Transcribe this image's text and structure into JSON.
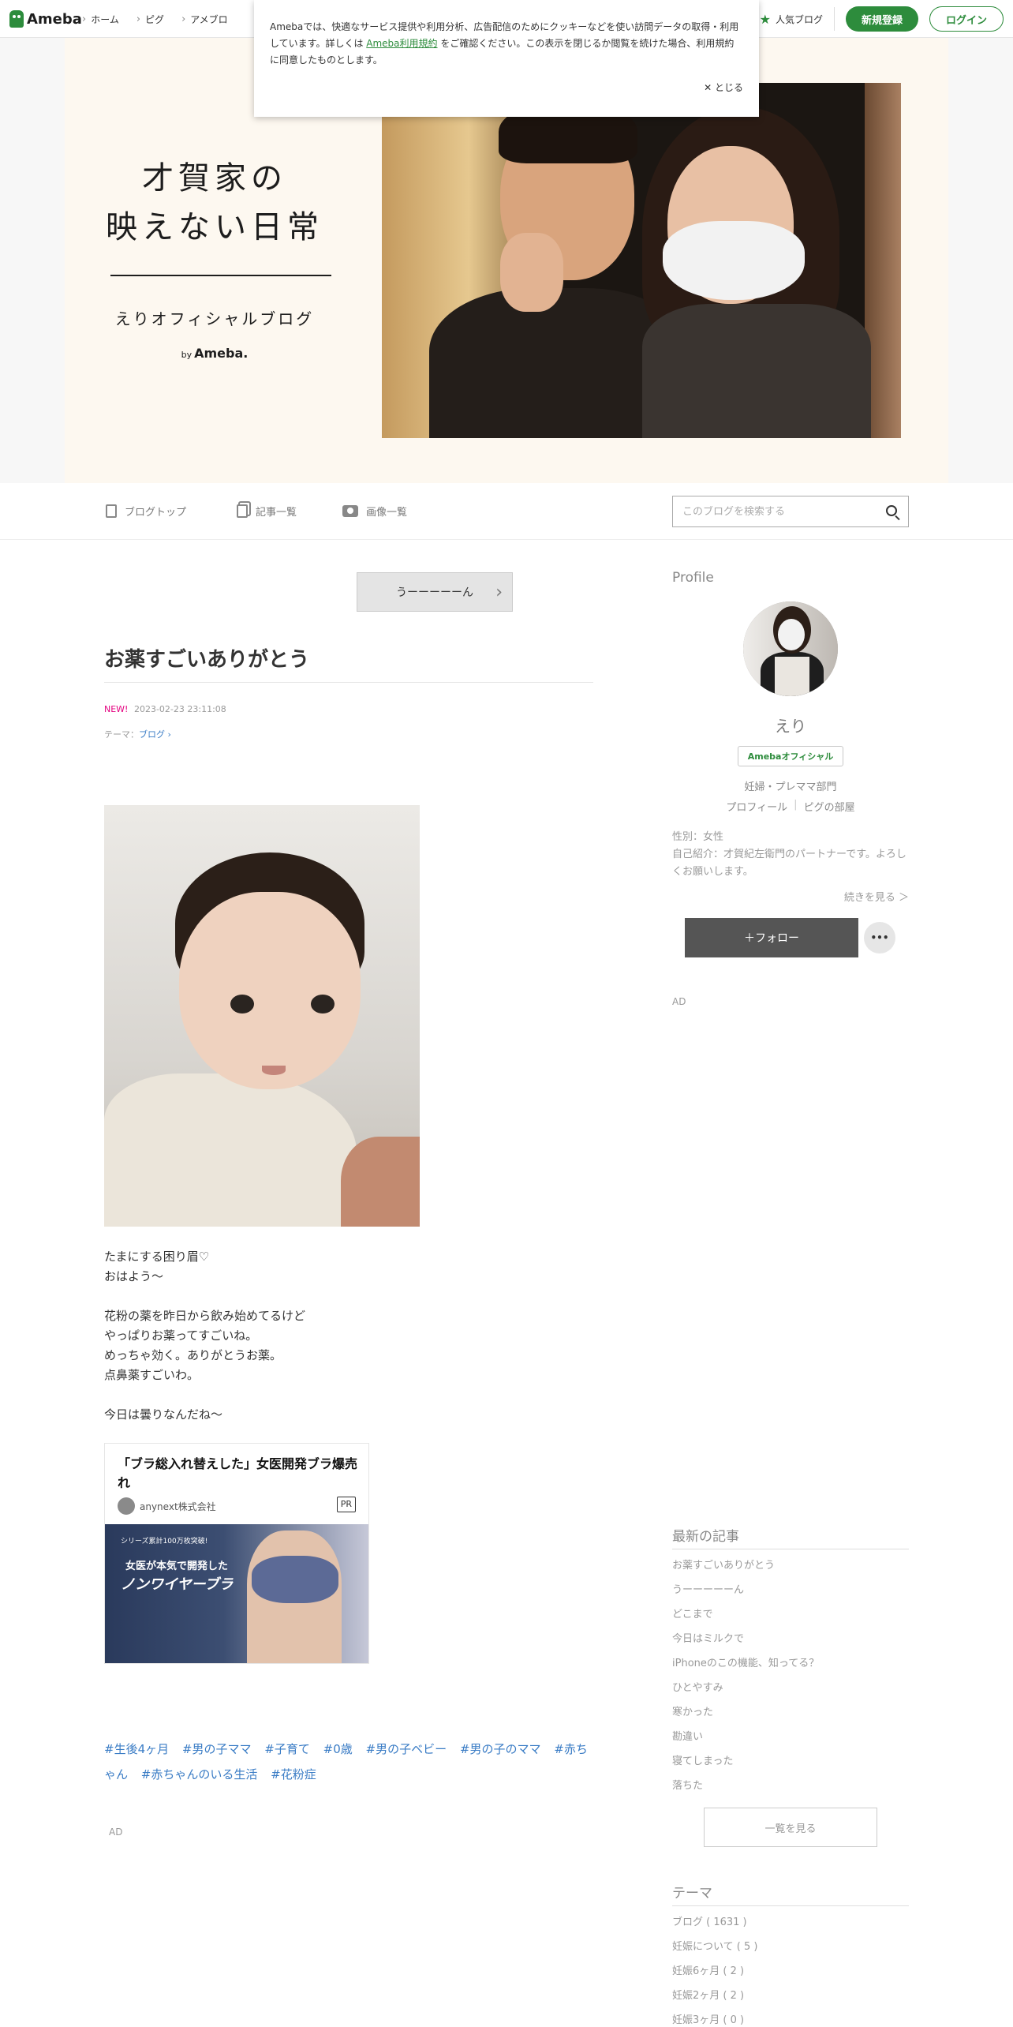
{
  "global": {
    "logo_text": "Ameba",
    "nav": [
      "ホーム",
      "ピグ",
      "アメブロ"
    ],
    "popular_blog": "人気ブログ",
    "register": "新規登録",
    "login": "ログイン",
    "accent_color": "#2d8c3c"
  },
  "cookie": {
    "text_before": "Amebaでは、快適なサービス提供や利用分析、広告配信のためにクッキーなどを使い訪問データの取得・利用しています。詳しくは ",
    "link": "Ameba利用規約",
    "text_after": " をご確認ください。この表示を閉じるか閲覧を続けた場合、利用規約に同意したものとします。",
    "close": "✕ とじる"
  },
  "header": {
    "title_line1": "才賀家の",
    "title_line2": "映えない日常",
    "subtitle": "えりオフィシャルブログ",
    "by": "by",
    "brand": "Ameba."
  },
  "blognav": {
    "top": "ブログトップ",
    "entries": "記事一覧",
    "images": "画像一覧",
    "search_placeholder": "このブログを検索する"
  },
  "article": {
    "prev_label": "うーーーーーん",
    "title": "お薬すごいありがとう",
    "new_badge": "NEW!",
    "datetime": "2023-02-23 23:11:08",
    "theme_prefix": "テーマ：",
    "theme": "ブログ",
    "body": [
      "たまにする困り眉♡",
      "おはよう〜",
      "",
      "花粉の薬を昨日から飲み始めてるけど",
      "やっぱりお薬ってすごいね。",
      "めっちゃ効く。ありがとうお薬。",
      "点鼻薬すごいわ。",
      "",
      "今日は曇りなんだね〜"
    ],
    "hashtags": [
      "#生後4ヶ月",
      "#男の子ママ",
      "#子育て",
      "#0歳",
      "#男の子ベビー",
      "#男の子のママ",
      "#赤ちゃん",
      "#赤ちゃんのいる生活",
      "#花粉症"
    ],
    "ad_label": "AD"
  },
  "adcard": {
    "title": "「ブラ総入れ替えした」女医開発ブラ爆売れ",
    "source": "anynext株式会社",
    "pr": "PR",
    "img_line1": "シリーズ累計100万枚突破!",
    "img_line2": "女医が本気で開発した",
    "img_line3": "ノンワイヤーブラ"
  },
  "sidebar": {
    "profile_heading": "Profile",
    "name": "えり",
    "badge": "Amebaオフィシャル",
    "category": "妊婦・プレママ部門",
    "profile_link": "プロフィール",
    "pig_link": "ピグの部屋",
    "info_gender": "性別：女性",
    "info_intro": "自己紹介：才賀紀左衛門のパートナーです。よろしくお願いします。",
    "more": "続きを見る ＞",
    "follow": "＋フォロー",
    "dots": "•••",
    "ad_label": "AD",
    "recent_heading": "最新の記事",
    "recent": [
      "お薬すごいありがとう",
      "うーーーーーん",
      "どこまで",
      "今日はミルクで",
      "iPhoneのこの機能、知ってる？",
      "ひとやすみ",
      "寒かった",
      "勘違い",
      "寝てしまった",
      "落ちた"
    ],
    "list_button": "一覧を見る",
    "themes_heading": "テーマ",
    "themes": [
      "ブログ ( 1631 )",
      "妊娠について ( 5 )",
      "妊娠6ヶ月 ( 2 )",
      "妊娠2ヶ月 ( 2 )",
      "妊娠3ヶ月 ( 0 )"
    ]
  }
}
